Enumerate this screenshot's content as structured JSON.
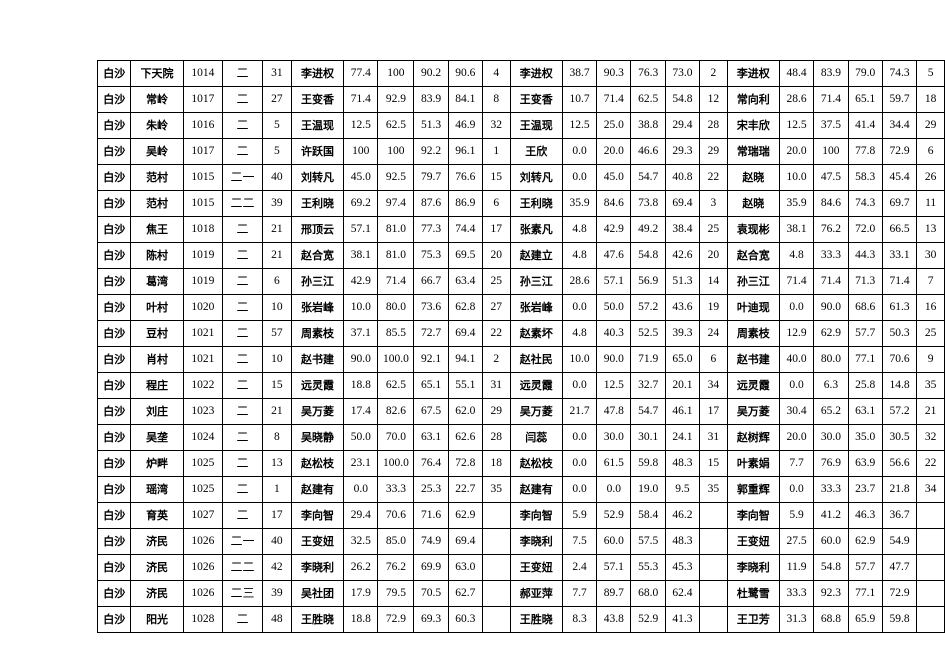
{
  "document": {
    "type": "spreadsheet-table",
    "row_count": 22,
    "column_count": 19,
    "columns": [
      {
        "key": "region",
        "group": "identity",
        "label": ""
      },
      {
        "key": "village",
        "group": "identity",
        "label": ""
      },
      {
        "key": "code",
        "group": "identity",
        "label": ""
      },
      {
        "key": "grade",
        "group": "identity",
        "label": ""
      },
      {
        "key": "count",
        "group": "identity",
        "label": ""
      },
      {
        "key": "name_a",
        "group": "block-a",
        "label": ""
      },
      {
        "key": "a1",
        "group": "block-a",
        "label": ""
      },
      {
        "key": "a2",
        "group": "block-a",
        "label": ""
      },
      {
        "key": "a3",
        "group": "block-a",
        "label": ""
      },
      {
        "key": "a4",
        "group": "block-a",
        "label": ""
      },
      {
        "key": "a_rank",
        "group": "block-a",
        "label": ""
      },
      {
        "key": "name_b",
        "group": "block-b",
        "label": ""
      },
      {
        "key": "b1",
        "group": "block-b",
        "label": ""
      },
      {
        "key": "b2",
        "group": "block-b",
        "label": ""
      },
      {
        "key": "b3",
        "group": "block-b",
        "label": ""
      },
      {
        "key": "b4",
        "group": "block-b",
        "label": ""
      },
      {
        "key": "b_rank",
        "group": "block-b",
        "label": ""
      },
      {
        "key": "name_c",
        "group": "block-c",
        "label": ""
      },
      {
        "key": "c1",
        "group": "block-c",
        "label": ""
      },
      {
        "key": "c2",
        "group": "block-c",
        "label": ""
      },
      {
        "key": "c3",
        "group": "block-c",
        "label": ""
      },
      {
        "key": "c4",
        "group": "block-c",
        "label": ""
      },
      {
        "key": "c_rank",
        "group": "block-c",
        "label": ""
      }
    ]
  },
  "rows": [
    {
      "region": "白沙",
      "village": "下天院",
      "code": "1014",
      "grade": "二",
      "count": "31",
      "name_a": "李进权",
      "a1": "77.4",
      "a2": "100",
      "a3": "90.2",
      "a4": "90.6",
      "a_rank": "4",
      "name_b": "李进权",
      "b1": "38.7",
      "b2": "90.3",
      "b3": "76.3",
      "b4": "73.0",
      "b_rank": "2",
      "name_c": "李进权",
      "c1": "48.4",
      "c2": "83.9",
      "c3": "79.0",
      "c4": "74.3",
      "c_rank": "5"
    },
    {
      "region": "白沙",
      "village": "常岭",
      "code": "1017",
      "grade": "二",
      "count": "27",
      "name_a": "王变香",
      "a1": "71.4",
      "a2": "92.9",
      "a3": "83.9",
      "a4": "84.1",
      "a_rank": "8",
      "name_b": "王变香",
      "b1": "10.7",
      "b2": "71.4",
      "b3": "62.5",
      "b4": "54.8",
      "b_rank": "12",
      "name_c": "常向利",
      "c1": "28.6",
      "c2": "71.4",
      "c3": "65.1",
      "c4": "59.7",
      "c_rank": "18"
    },
    {
      "region": "白沙",
      "village": "朱岭",
      "code": "1016",
      "grade": "二",
      "count": "5",
      "name_a": "王温现",
      "a1": "12.5",
      "a2": "62.5",
      "a3": "51.3",
      "a4": "46.9",
      "a_rank": "32",
      "name_b": "王温现",
      "b1": "12.5",
      "b2": "25.0",
      "b3": "38.8",
      "b4": "29.4",
      "b_rank": "28",
      "name_c": "宋丰欣",
      "c1": "12.5",
      "c2": "37.5",
      "c3": "41.4",
      "c4": "34.4",
      "c_rank": "29"
    },
    {
      "region": "白沙",
      "village": "吴岭",
      "code": "1017",
      "grade": "二",
      "count": "5",
      "name_a": "许跃国",
      "a1": "100",
      "a2": "100",
      "a3": "92.2",
      "a4": "96.1",
      "a_rank": "1",
      "name_b": "王欣",
      "b1": "0.0",
      "b2": "20.0",
      "b3": "46.6",
      "b4": "29.3",
      "b_rank": "29",
      "name_c": "常瑞瑞",
      "c1": "20.0",
      "c2": "100",
      "c3": "77.8",
      "c4": "72.9",
      "c_rank": "6"
    },
    {
      "region": "白沙",
      "village": "范村",
      "code": "1015",
      "grade": "二一",
      "count": "40",
      "name_a": "刘转凡",
      "a1": "45.0",
      "a2": "92.5",
      "a3": "79.7",
      "a4": "76.6",
      "a_rank": "15",
      "name_b": "刘转凡",
      "b1": "0.0",
      "b2": "45.0",
      "b3": "54.7",
      "b4": "40.8",
      "b_rank": "22",
      "name_c": "赵晓",
      "c1": "10.0",
      "c2": "47.5",
      "c3": "58.3",
      "c4": "45.4",
      "c_rank": "26"
    },
    {
      "region": "白沙",
      "village": "范村",
      "code": "1015",
      "grade": "二二",
      "count": "39",
      "name_a": "王利晓",
      "a1": "69.2",
      "a2": "97.4",
      "a3": "87.6",
      "a4": "86.9",
      "a_rank": "6",
      "name_b": "王利晓",
      "b1": "35.9",
      "b2": "84.6",
      "b3": "73.8",
      "b4": "69.4",
      "b_rank": "3",
      "name_c": "赵晓",
      "c1": "35.9",
      "c2": "84.6",
      "c3": "74.3",
      "c4": "69.7",
      "c_rank": "11"
    },
    {
      "region": "白沙",
      "village": "焦王",
      "code": "1018",
      "grade": "二",
      "count": "21",
      "name_a": "邢顶云",
      "a1": "57.1",
      "a2": "81.0",
      "a3": "77.3",
      "a4": "74.4",
      "a_rank": "17",
      "name_b": "张素凡",
      "b1": "4.8",
      "b2": "42.9",
      "b3": "49.2",
      "b4": "38.4",
      "b_rank": "25",
      "name_c": "袁现彬",
      "c1": "38.1",
      "c2": "76.2",
      "c3": "72.0",
      "c4": "66.5",
      "c_rank": "13"
    },
    {
      "region": "白沙",
      "village": "陈村",
      "code": "1019",
      "grade": "二",
      "count": "21",
      "name_a": "赵合宽",
      "a1": "38.1",
      "a2": "81.0",
      "a3": "75.3",
      "a4": "69.5",
      "a_rank": "20",
      "name_b": "赵建立",
      "b1": "4.8",
      "b2": "47.6",
      "b3": "54.8",
      "b4": "42.6",
      "b_rank": "20",
      "name_c": "赵合宽",
      "c1": "4.8",
      "c2": "33.3",
      "c3": "44.3",
      "c4": "33.1",
      "c_rank": "30"
    },
    {
      "region": "白沙",
      "village": "葛湾",
      "code": "1019",
      "grade": "二",
      "count": "6",
      "name_a": "孙三江",
      "a1": "42.9",
      "a2": "71.4",
      "a3": "66.7",
      "a4": "63.4",
      "a_rank": "25",
      "name_b": "孙三江",
      "b1": "28.6",
      "b2": "57.1",
      "b3": "56.9",
      "b4": "51.3",
      "b_rank": "14",
      "name_c": "孙三江",
      "c1": "71.4",
      "c2": "71.4",
      "c3": "71.3",
      "c4": "71.4",
      "c_rank": "7"
    },
    {
      "region": "白沙",
      "village": "叶村",
      "code": "1020",
      "grade": "二",
      "count": "10",
      "name_a": "张岩峰",
      "a1": "10.0",
      "a2": "80.0",
      "a3": "73.6",
      "a4": "62.8",
      "a_rank": "27",
      "name_b": "张岩峰",
      "b1": "0.0",
      "b2": "50.0",
      "b3": "57.2",
      "b4": "43.6",
      "b_rank": "19",
      "name_c": "叶迪现",
      "c1": "0.0",
      "c2": "90.0",
      "c3": "68.6",
      "c4": "61.3",
      "c_rank": "16"
    },
    {
      "region": "白沙",
      "village": "豆村",
      "code": "1021",
      "grade": "二",
      "count": "57",
      "name_a": "周素枝",
      "a1": "37.1",
      "a2": "85.5",
      "a3": "72.7",
      "a4": "69.4",
      "a_rank": "22",
      "name_b": "赵素坏",
      "b1": "4.8",
      "b2": "40.3",
      "b3": "52.5",
      "b4": "39.3",
      "b_rank": "24",
      "name_c": "周素枝",
      "c1": "12.9",
      "c2": "62.9",
      "c3": "57.7",
      "c4": "50.3",
      "c_rank": "25"
    },
    {
      "region": "白沙",
      "village": "肖村",
      "code": "1021",
      "grade": "二",
      "count": "10",
      "name_a": "赵书建",
      "a1": "90.0",
      "a2": "100.0",
      "a3": "92.1",
      "a4": "94.1",
      "a_rank": "2",
      "name_b": "赵社民",
      "b1": "10.0",
      "b2": "90.0",
      "b3": "71.9",
      "b4": "65.0",
      "b_rank": "6",
      "name_c": "赵书建",
      "c1": "40.0",
      "c2": "80.0",
      "c3": "77.1",
      "c4": "70.6",
      "c_rank": "9"
    },
    {
      "region": "白沙",
      "village": "程庄",
      "code": "1022",
      "grade": "二",
      "count": "15",
      "name_a": "远灵霞",
      "a1": "18.8",
      "a2": "62.5",
      "a3": "65.1",
      "a4": "55.1",
      "a_rank": "31",
      "name_b": "远灵霞",
      "b1": "0.0",
      "b2": "12.5",
      "b3": "32.7",
      "b4": "20.1",
      "b_rank": "34",
      "name_c": "远灵霞",
      "c1": "0.0",
      "c2": "6.3",
      "c3": "25.8",
      "c4": "14.8",
      "c_rank": "35"
    },
    {
      "region": "白沙",
      "village": "刘庄",
      "code": "1023",
      "grade": "二",
      "count": "21",
      "name_a": "吴万菱",
      "a1": "17.4",
      "a2": "82.6",
      "a3": "67.5",
      "a4": "62.0",
      "a_rank": "29",
      "name_b": "吴万菱",
      "b1": "21.7",
      "b2": "47.8",
      "b3": "54.7",
      "b4": "46.1",
      "b_rank": "17",
      "name_c": "吴万菱",
      "c1": "30.4",
      "c2": "65.2",
      "c3": "63.1",
      "c4": "57.2",
      "c_rank": "21"
    },
    {
      "region": "白沙",
      "village": "吴垄",
      "code": "1024",
      "grade": "二",
      "count": "8",
      "name_a": "吴晓静",
      "a1": "50.0",
      "a2": "70.0",
      "a3": "63.1",
      "a4": "62.6",
      "a_rank": "28",
      "name_b": "闫蕊",
      "b1": "0.0",
      "b2": "30.0",
      "b3": "30.1",
      "b4": "24.1",
      "b_rank": "31",
      "name_c": "赵树辉",
      "c1": "20.0",
      "c2": "30.0",
      "c3": "35.0",
      "c4": "30.5",
      "c_rank": "32"
    },
    {
      "region": "白沙",
      "village": "炉畔",
      "code": "1025",
      "grade": "二",
      "count": "13",
      "name_a": "赵松枝",
      "a1": "23.1",
      "a2": "100.0",
      "a3": "76.4",
      "a4": "72.8",
      "a_rank": "18",
      "name_b": "赵松枝",
      "b1": "0.0",
      "b2": "61.5",
      "b3": "59.8",
      "b4": "48.3",
      "b_rank": "15",
      "name_c": "叶素娟",
      "c1": "7.7",
      "c2": "76.9",
      "c3": "63.9",
      "c4": "56.6",
      "c_rank": "22"
    },
    {
      "region": "白沙",
      "village": "瑶湾",
      "code": "1025",
      "grade": "二",
      "count": "1",
      "name_a": "赵建有",
      "a1": "0.0",
      "a2": "33.3",
      "a3": "25.3",
      "a4": "22.7",
      "a_rank": "35",
      "name_b": "赵建有",
      "b1": "0.0",
      "b2": "0.0",
      "b3": "19.0",
      "b4": "9.5",
      "b_rank": "35",
      "name_c": "郭重辉",
      "c1": "0.0",
      "c2": "33.3",
      "c3": "23.7",
      "c4": "21.8",
      "c_rank": "34"
    },
    {
      "region": "白沙",
      "village": "育英",
      "code": "1027",
      "grade": "二",
      "count": "17",
      "name_a": "李向智",
      "a1": "29.4",
      "a2": "70.6",
      "a3": "71.6",
      "a4": "62.9",
      "a_rank": "",
      "name_b": "李向智",
      "b1": "5.9",
      "b2": "52.9",
      "b3": "58.4",
      "b4": "46.2",
      "b_rank": "",
      "name_c": "李向智",
      "c1": "5.9",
      "c2": "41.2",
      "c3": "46.3",
      "c4": "36.7",
      "c_rank": ""
    },
    {
      "region": "白沙",
      "village": "济民",
      "code": "1026",
      "grade": "二一",
      "count": "40",
      "name_a": "王变妞",
      "a1": "32.5",
      "a2": "85.0",
      "a3": "74.9",
      "a4": "69.4",
      "a_rank": "",
      "name_b": "李晓利",
      "b1": "7.5",
      "b2": "60.0",
      "b3": "57.5",
      "b4": "48.3",
      "b_rank": "",
      "name_c": "王变妞",
      "c1": "27.5",
      "c2": "60.0",
      "c3": "62.9",
      "c4": "54.9",
      "c_rank": ""
    },
    {
      "region": "白沙",
      "village": "济民",
      "code": "1026",
      "grade": "二二",
      "count": "42",
      "name_a": "李晓利",
      "a1": "26.2",
      "a2": "76.2",
      "a3": "69.9",
      "a4": "63.0",
      "a_rank": "",
      "name_b": "王变妞",
      "b1": "2.4",
      "b2": "57.1",
      "b3": "55.3",
      "b4": "45.3",
      "b_rank": "",
      "name_c": "李晓利",
      "c1": "11.9",
      "c2": "54.8",
      "c3": "57.7",
      "c4": "47.7",
      "c_rank": ""
    },
    {
      "region": "白沙",
      "village": "济民",
      "code": "1026",
      "grade": "二三",
      "count": "39",
      "name_a": "吴社团",
      "a1": "17.9",
      "a2": "79.5",
      "a3": "70.5",
      "a4": "62.7",
      "a_rank": "",
      "name_b": "郝亚萍",
      "b1": "7.7",
      "b2": "89.7",
      "b3": "68.0",
      "b4": "62.4",
      "b_rank": "",
      "name_c": "杜鹭雪",
      "c1": "33.3",
      "c2": "92.3",
      "c3": "77.1",
      "c4": "72.9",
      "c_rank": ""
    },
    {
      "region": "白沙",
      "village": "阳光",
      "code": "1028",
      "grade": "二",
      "count": "48",
      "name_a": "王胜晓",
      "a1": "18.8",
      "a2": "72.9",
      "a3": "69.3",
      "a4": "60.3",
      "a_rank": "",
      "name_b": "王胜晓",
      "b1": "8.3",
      "b2": "43.8",
      "b3": "52.9",
      "b4": "41.3",
      "b_rank": "",
      "name_c": "王卫芳",
      "c1": "31.3",
      "c2": "68.8",
      "c3": "65.9",
      "c4": "59.8",
      "c_rank": ""
    }
  ]
}
